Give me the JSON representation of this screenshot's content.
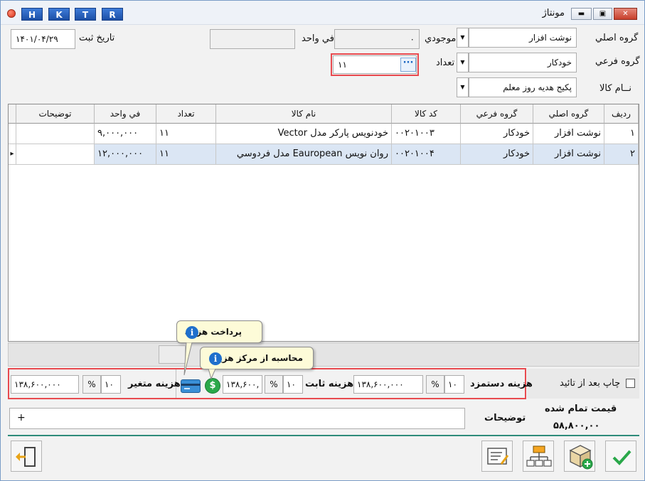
{
  "window": {
    "title": "مونتاژ",
    "hotkeys": [
      "H",
      "K",
      "T",
      "R"
    ],
    "minimize_glyph": "▬",
    "restore_glyph": "▣",
    "close_glyph": "✕"
  },
  "form": {
    "main_group_label": "گروه اصلي",
    "main_group_value": "نوشت افزار",
    "sub_group_label": "گروه فرعي",
    "sub_group_value": "خودکار",
    "item_name_label": "نــام کالا",
    "item_name_value": "پکيج هديه روز معلم",
    "stock_label": "موجودي",
    "stock_value": "۰",
    "unit_price_label": "في واحد",
    "unit_price_value": "",
    "quantity_label": "تعداد",
    "quantity_value": "۱۱",
    "quantity_button": "···",
    "date_label": "تاريخ ثبت",
    "date_value": "۱۴۰۱/۰۴/۲۹",
    "dropdown_glyph": "▼"
  },
  "grid": {
    "columns": [
      "رديف",
      "گروه اصلي",
      "گروه فرعي",
      "کد کالا",
      "نام کالا",
      "تعداد",
      "في واحد",
      "توضيحات"
    ],
    "rows": [
      {
        "row": "۱",
        "main_group": "نوشت افزار",
        "sub_group": "خودکار",
        "code": "۰۰۲۰۱۰۰۳",
        "name": "خودنويس پارکر مدل Vector",
        "qty": "۱۱",
        "unit_price": "۹,۰۰۰,۰۰۰",
        "desc": ""
      },
      {
        "row": "۲",
        "main_group": "نوشت افزار",
        "sub_group": "خودکار",
        "code": "۰۰۲۰۱۰۰۴",
        "name": "روان نويس Eauropean مدل فردوسي",
        "qty": "۱۱",
        "unit_price": "۱۲,۰۰۰,۰۰۰",
        "desc": ""
      }
    ],
    "row_pointer": "▸"
  },
  "costs": {
    "print_after_confirm_label": "چاپ بعد از تائيد",
    "labor_label": "هزينه دستمزد",
    "labor_percent": "۱۰",
    "labor_value": "۱۳۸,۶۰۰,۰۰۰",
    "fixed_label": "هزينه ثابت",
    "fixed_percent": "۱۰",
    "fixed_value": "۱۳۸,۶۰۰,",
    "variable_label": "هزينه متغير",
    "variable_percent": "۱۰",
    "variable_value": "۱۳۸,۶۰۰,۰۰۰",
    "percent_sign": "%",
    "dollar_glyph": "$",
    "tooltip_payment": "پرداخت هزينه",
    "tooltip_cost_center": "محاسبه از مرکز هزينه",
    "info_glyph": "i"
  },
  "bottom": {
    "description_label": "توضيحات",
    "add_glyph": "+",
    "finished_price_label": "قيمت تمام شده",
    "finished_price_value": "۵۸,۸۰۰,۰۰"
  },
  "colors": {
    "highlight_frame": "#e84a4f",
    "confirm_green": "#2aa84a",
    "hotkey_blue": "#1c4fa6",
    "tooltip_bg": "#fdfbd8",
    "selected_row": "#dbe6f4"
  }
}
